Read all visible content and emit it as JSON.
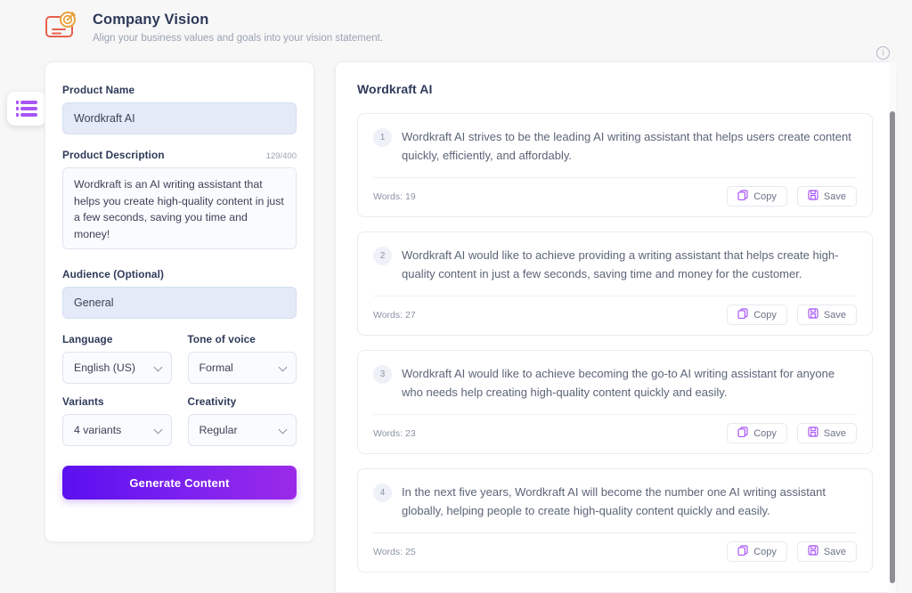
{
  "header": {
    "title": "Company Vision",
    "subtitle": "Align your business values and goals into your vision statement.",
    "icon": "vision-target-icon",
    "info_icon": "info-circle-icon",
    "icon_color_card": "#e8604c",
    "icon_color_target": "#e8a33d"
  },
  "sidebar_toggle": {
    "icon": "list-menu-icon",
    "color": "#a855f7"
  },
  "form": {
    "product_name": {
      "label": "Product Name",
      "value": "Wordkraft AI",
      "placeholder": "Product Name"
    },
    "product_description": {
      "label": "Product Description",
      "char_count": "129/400",
      "value": "Wordkraft is an AI writing assistant that helps you create high-quality content in just a few seconds, saving you time and money!",
      "placeholder": "Product Description"
    },
    "audience": {
      "label": "Audience (Optional)",
      "value": "General",
      "placeholder": "Audience"
    },
    "language": {
      "label": "Language",
      "value": "English (US)"
    },
    "tone": {
      "label": "Tone of voice",
      "value": "Formal"
    },
    "variants": {
      "label": "Variants",
      "value": "4 variants"
    },
    "creativity": {
      "label": "Creativity",
      "value": "Regular"
    },
    "generate_button": {
      "label": "Generate Content",
      "color": "#6610f2"
    }
  },
  "results": {
    "title": "Wordkraft AI",
    "copy_label": "Copy",
    "save_label": "Save",
    "copy_icon": "copy-icon",
    "save_icon": "save-floppy-icon",
    "accent_color": "#a855f7",
    "items": [
      {
        "number": "1",
        "text": "Wordkraft AI strives to be the leading AI writing assistant that helps users create content quickly, efficiently, and affordably.",
        "words": "Words: 19"
      },
      {
        "number": "2",
        "text": "Wordkraft AI would like to achieve providing a writing assistant that helps create high-quality content in just a few seconds, saving time and money for the customer.",
        "words": "Words: 27"
      },
      {
        "number": "3",
        "text": "Wordkraft AI would like to achieve becoming the go-to AI writing assistant for anyone who needs help creating high-quality content quickly and easily.",
        "words": "Words: 23"
      },
      {
        "number": "4",
        "text": "In the next five years, Wordkraft AI will become the number one AI writing assistant globally, helping people to create high-quality content quickly and easily.",
        "words": "Words: 25"
      }
    ]
  }
}
